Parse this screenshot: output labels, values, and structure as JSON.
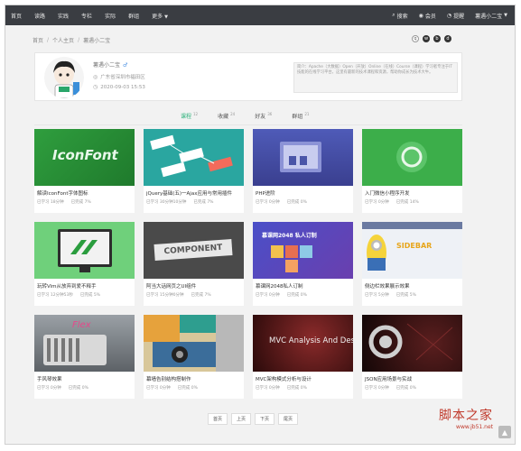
{
  "nav": {
    "items": [
      "首页",
      "读路",
      "实践",
      "专栏",
      "实际",
      "群组"
    ],
    "more": "更多"
  },
  "topright": {
    "search": "搜索",
    "vip": "会员",
    "notify": "提醒",
    "user": "薯遇小二宝"
  },
  "breadcrumb": [
    "首页",
    "个人主页",
    "薯遇小二宝"
  ],
  "profile": {
    "name": "薯遇小二宝",
    "sex": "♂",
    "location": "广东省深圳市福田区",
    "date": "2020-09-03 15:53",
    "bio": "简介：Apache（大数据）Open（开放）Online（在线）Course（课程）学习者专注于IT技能的在线学习平台，这里有最新的技术课程和资源，帮助你成长为技术大牛。"
  },
  "tabs": [
    {
      "label": "课程",
      "count": "12"
    },
    {
      "label": "收藏",
      "count": "24"
    },
    {
      "label": "好友",
      "count": "36"
    },
    {
      "label": "群组",
      "count": "21"
    }
  ],
  "courses": [
    {
      "title": "解读IconFont字体图标",
      "studied": "已学习 18分钟",
      "progress": "已完成 7%",
      "thumb_text": "IconFont"
    },
    {
      "title": "jQuery基础(五)一Ajax应用与常用插件",
      "studied": "已学习 30分钟10分钟",
      "progress": "已完成 7%",
      "thumb_text": ""
    },
    {
      "title": "PHP进阶",
      "studied": "已学习 0分钟",
      "progress": "已完成 0%",
      "thumb_text": ""
    },
    {
      "title": "入门微信小程序开发",
      "studied": "已学习 0分钟",
      "progress": "已完成 14%",
      "thumb_text": ""
    },
    {
      "title": "玩转Vim从放弃到爱不释手",
      "studied": "已学习 12分钟53秒",
      "progress": "已完成 5%",
      "thumb_text": ""
    },
    {
      "title": "阿当大话网页之UI组件",
      "studied": "已学习 15分钟0分钟",
      "progress": "已完成 7%",
      "thumb_text": "COMPONENT"
    },
    {
      "title": "慕课网2048私人订制",
      "studied": "已学习 0分钟",
      "progress": "已完成 0%",
      "thumb_text": "慕课网2048 私人订制"
    },
    {
      "title": "侧边栏效果展示效果",
      "studied": "已学习 5分钟",
      "progress": "已完成 5%",
      "thumb_text": "SIDEBAR"
    },
    {
      "title": "手风琴效果",
      "studied": "已学习 0分钟",
      "progress": "已完成 0%",
      "thumb_text": "Flex"
    },
    {
      "title": "幕墙告别结构搭制作",
      "studied": "已学习 0分钟",
      "progress": "已完成 0%",
      "thumb_text": ""
    },
    {
      "title": "MVC架构模式分析与设计",
      "studied": "已学习 0分钟",
      "progress": "已完成 0%",
      "thumb_text": "MVC Analysis And Design"
    },
    {
      "title": "JSON应用场景与实战",
      "studied": "已学习 0分钟",
      "progress": "已完成 0%",
      "thumb_text": ""
    }
  ],
  "pager": [
    "首页",
    "上页",
    "下页",
    "尾页"
  ],
  "watermark": {
    "cn": "脚本之家",
    "url": "www.jb51.net"
  },
  "colors": {
    "accent": "#2db27b",
    "topbar": "#3a3d42"
  }
}
